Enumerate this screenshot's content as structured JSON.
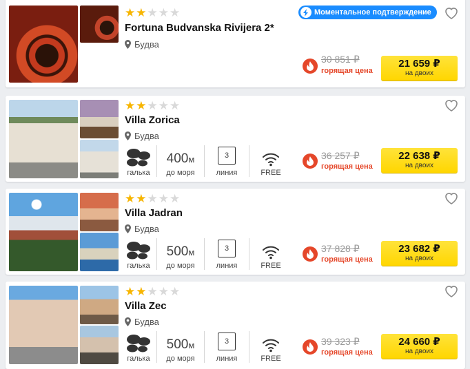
{
  "colors": {
    "accent_yellow": "#ffd600",
    "badge_blue": "#1a8cff",
    "hot_red": "#e5472a",
    "star_gold": "#f7b500"
  },
  "labels": {
    "instant_confirmation": "Моментальное подтверждение",
    "hot_price": "горящая цена",
    "for_two": "на двоих",
    "pebbles": "галька",
    "to_sea": "до моря",
    "line": "линия",
    "wifi": "FREE"
  },
  "hotels": [
    {
      "name": "Fortuna Budvanska Rivijera 2*",
      "stars": 2,
      "max_stars": 5,
      "location": "Будва",
      "instant_confirmation": true,
      "old_price": "30 851 ₽",
      "price": "21 659 ₽",
      "photos": [
        "roulette",
        "roulette"
      ],
      "icons": [
        "map-pin-icon",
        "heart-icon",
        "lightning-icon",
        "flame-icon"
      ]
    },
    {
      "name": "Villa Zorica",
      "stars": 2,
      "max_stars": 5,
      "location": "Будва",
      "distance": "400",
      "distance_unit": "м",
      "line_number": "3",
      "old_price": "36 257 ₽",
      "price": "22 638 ₽",
      "photos": [
        "villa exterior",
        "bedroom",
        "villa exterior"
      ],
      "icons": [
        "pebbles-icon",
        "wifi-icon",
        "flame-icon"
      ]
    },
    {
      "name": "Villa Jadran",
      "stars": 2,
      "max_stars": 5,
      "location": "Будва",
      "distance": "500",
      "distance_unit": "м",
      "line_number": "3",
      "old_price": "37 828 ₽",
      "price": "23 682 ₽",
      "photos": [
        "town view",
        "room",
        "pool"
      ],
      "icons": [
        "pebbles-icon",
        "wifi-icon",
        "flame-icon"
      ]
    },
    {
      "name": "Villa Zec",
      "stars": 2,
      "max_stars": 5,
      "location": "Будва",
      "distance": "500",
      "distance_unit": "м",
      "line_number": "3",
      "old_price": "39 323 ₽",
      "price": "24 660 ₽",
      "photos": [
        "villa facade",
        "balcony",
        "street"
      ],
      "icons": [
        "pebbles-icon",
        "wifi-icon",
        "flame-icon"
      ]
    }
  ]
}
